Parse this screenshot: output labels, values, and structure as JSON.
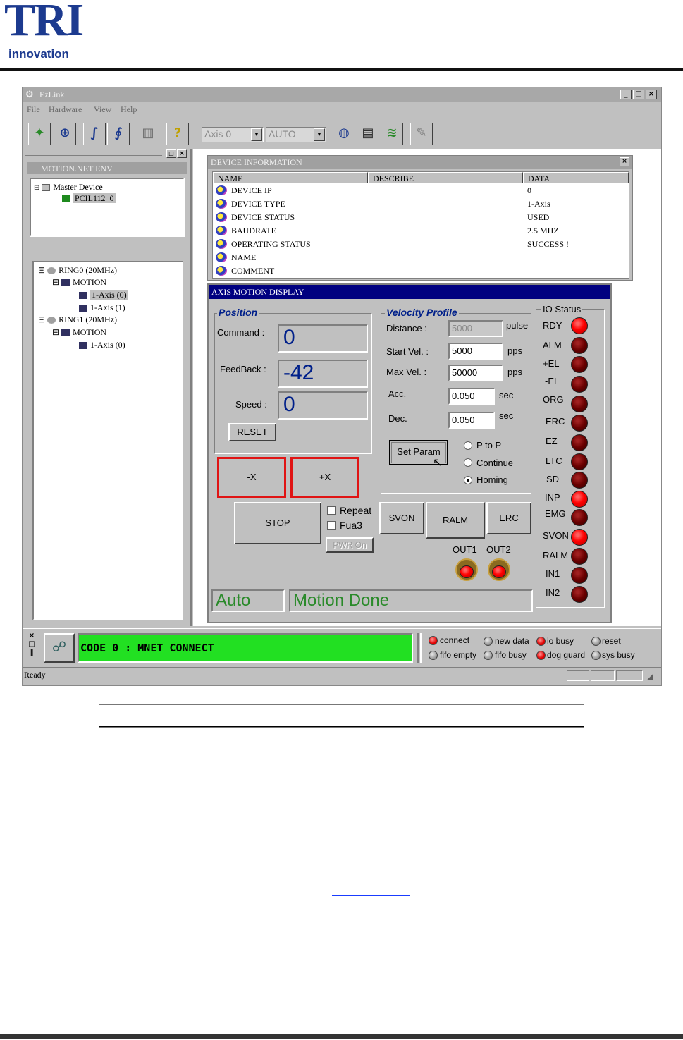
{
  "brand": {
    "logo_text": "TRI",
    "logo_sub": "innovation",
    "primary_color": "#1c3a8f"
  },
  "window": {
    "title": "EzLink",
    "menu": [
      "File",
      "Hardware",
      "View",
      "Help"
    ],
    "toolbar": {
      "axis_select": "Axis 0",
      "mode_select": "AUTO",
      "icons": [
        "wand-icon",
        "search-icon",
        "link-icon",
        "link2-icon",
        "chart-icon",
        "help-icon",
        "motor-icon",
        "save-icon",
        "wave-icon",
        "tool-icon"
      ]
    }
  },
  "left_pane": {
    "header": "MOTION.NET ENV",
    "master_tree": {
      "root": "Master Device",
      "child": "PCIL112_0"
    },
    "ring_tree": [
      {
        "label": "RING0 (20MHz)",
        "level": 0
      },
      {
        "label": "MOTION",
        "level": 1
      },
      {
        "label": "1-Axis (0)",
        "level": 2,
        "selected": true
      },
      {
        "label": "1-Axis (1)",
        "level": 2
      },
      {
        "label": "RING1 (20MHz)",
        "level": 0
      },
      {
        "label": "MOTION",
        "level": 1
      },
      {
        "label": "1-Axis (0)",
        "level": 2
      }
    ]
  },
  "device_info": {
    "header": "DEVICE INFORMATION",
    "columns": [
      "NAME",
      "DESCRIBE",
      "DATA"
    ],
    "rows": [
      {
        "name": "DEVICE IP",
        "describe": "",
        "data": "0"
      },
      {
        "name": "DEVICE TYPE",
        "describe": "",
        "data": "1-Axis"
      },
      {
        "name": "DEVICE STATUS",
        "describe": "",
        "data": "USED"
      },
      {
        "name": "BAUDRATE",
        "describe": "",
        "data": "2.5 MHZ"
      },
      {
        "name": "OPERATING STATUS",
        "describe": "",
        "data": "SUCCESS !"
      },
      {
        "name": "NAME",
        "describe": "",
        "data": ""
      },
      {
        "name": "COMMENT",
        "describe": "",
        "data": ""
      }
    ]
  },
  "axis_display": {
    "header": "AXIS MOTION DISPLAY",
    "position": {
      "title": "Position",
      "command_label": "Command :",
      "command_value": "0",
      "feedback_label": "FeedBack :",
      "feedback_value": "-42",
      "speed_label": "Speed :",
      "speed_value": "0",
      "reset_label": "RESET"
    },
    "velocity": {
      "title": "Velocity Profile",
      "distance_label": "Distance :",
      "distance_value": "5000",
      "distance_unit": "pulse",
      "start_label": "Start Vel. :",
      "start_value": "5000",
      "start_unit": "pps",
      "max_label": "Max Vel. :",
      "max_value": "50000",
      "max_unit": "pps",
      "acc_label": "Acc.",
      "acc_value": "0.050",
      "acc_unit": "sec",
      "dec_label": "Dec.",
      "dec_value": "0.050",
      "dec_unit": "sec",
      "set_param_label": "Set Param",
      "modes": [
        {
          "label": "P to P",
          "selected": false
        },
        {
          "label": "Continue",
          "selected": false
        },
        {
          "label": "Homing",
          "selected": true
        }
      ]
    },
    "jog": {
      "minus_label": "-X",
      "plus_label": "+X",
      "stop_label": "STOP"
    },
    "options": {
      "repeat_label": "Repeat",
      "fua3_label": "Fua3",
      "pwr_on_label": "PWR On"
    },
    "controls": {
      "svon_label": "SVON",
      "ralm_label": "RALM",
      "erc_label": "ERC",
      "out1_label": "OUT1",
      "out2_label": "OUT2"
    },
    "status": {
      "mode_text": "Auto",
      "motion_text": "Motion Done"
    },
    "io_status": {
      "title": "IO Status",
      "items": [
        {
          "label": "RDY",
          "on": true
        },
        {
          "label": "ALM",
          "on": false
        },
        {
          "label": "+EL",
          "on": false
        },
        {
          "label": "-EL",
          "on": false
        },
        {
          "label": "ORG",
          "on": false
        },
        {
          "label": "ERC",
          "on": false
        },
        {
          "label": "EZ",
          "on": false
        },
        {
          "label": "LTC",
          "on": false
        },
        {
          "label": "SD",
          "on": false
        },
        {
          "label": "INP",
          "on": true
        },
        {
          "label": "EMG",
          "on": false
        },
        {
          "label": "SVON",
          "on": true
        },
        {
          "label": "RALM",
          "on": false
        },
        {
          "label": "IN1",
          "on": false
        },
        {
          "label": "IN2",
          "on": false
        }
      ]
    }
  },
  "bottom": {
    "code_message": "CODE 0 : MNET CONNECT",
    "indicators": [
      {
        "label": "connect",
        "on": true
      },
      {
        "label": "new data",
        "on": false
      },
      {
        "label": "io busy",
        "on": true
      },
      {
        "label": "reset",
        "on": false
      },
      {
        "label": "fifo empty",
        "on": false
      },
      {
        "label": "fifo busy",
        "on": false
      },
      {
        "label": "dog guard",
        "on": true
      },
      {
        "label": "sys busy",
        "on": false
      }
    ],
    "status_text": "Ready"
  },
  "colors": {
    "active_led": "#ff0000",
    "inactive_led": "#6a0000",
    "code_bar": "#22e022",
    "jog_border": "#e01414"
  }
}
